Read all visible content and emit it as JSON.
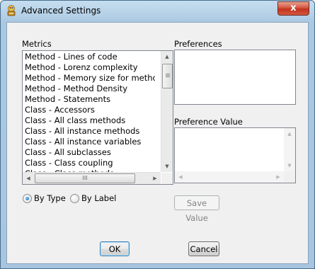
{
  "window": {
    "title": "Advanced Settings",
    "close_label": "x"
  },
  "metrics": {
    "label": "Metrics",
    "items": [
      "Method - Lines of code",
      "Method - Lorenz complexity",
      "Method - Memory size for method",
      "Method - Method Density",
      "Method - Statements",
      "Class - Accessors",
      "Class - All class methods",
      "Class - All instance methods",
      "Class - All instance variables",
      "Class - All subclasses",
      "Class - Class coupling",
      "Class - Class methods"
    ]
  },
  "preferences": {
    "label": "Preferences"
  },
  "preference_value": {
    "label": "Preference Value"
  },
  "sort": {
    "by_type_label": "By Type",
    "by_label_label": "By Label",
    "selected": "By Type"
  },
  "buttons": {
    "save_value": "Save Value",
    "ok": "OK",
    "cancel": "Cancel"
  },
  "scrollbar": {
    "grip_glyph": "III",
    "up": "▲",
    "down": "▼",
    "left": "◀",
    "right": "▶"
  }
}
